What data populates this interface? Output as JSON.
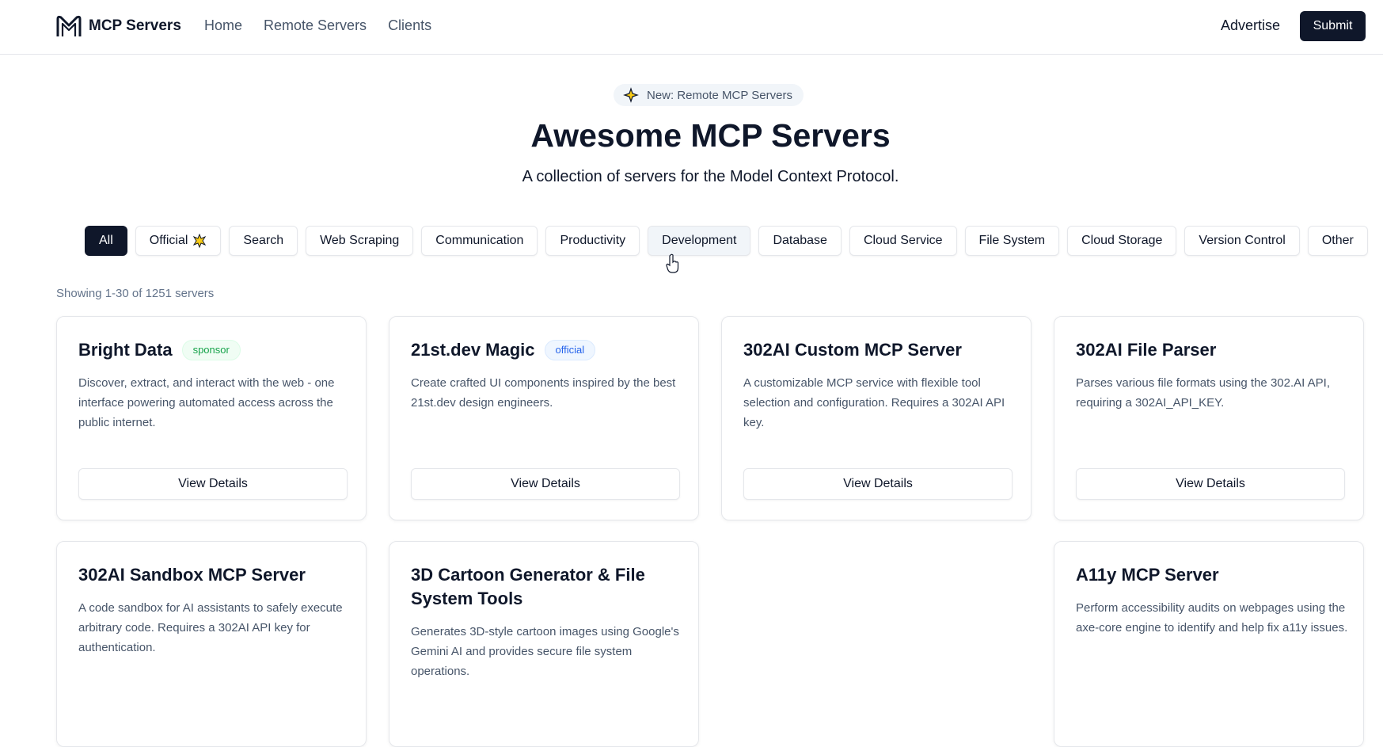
{
  "header": {
    "logo_text": "MCP Servers",
    "nav": [
      "Home",
      "Remote Servers",
      "Clients"
    ],
    "advertise": "Advertise",
    "submit": "Submit"
  },
  "hero": {
    "announcement": "New: Remote MCP Servers",
    "title": "Awesome MCP Servers",
    "subtitle": "A collection of servers for the Model Context Protocol."
  },
  "filters": {
    "items": [
      "All",
      "Official",
      "Search",
      "Web Scraping",
      "Communication",
      "Productivity",
      "Development",
      "Database",
      "Cloud Service",
      "File System",
      "Cloud Storage",
      "Version Control",
      "Other"
    ],
    "active": "All"
  },
  "showing": "Showing 1-30 of 1251 servers",
  "cards": [
    {
      "title": "Bright Data",
      "badge": "sponsor",
      "desc": "Discover, extract, and interact with the web - one interface powering automated access across the public internet.",
      "button": "View Details"
    },
    {
      "title": "21st.dev Magic",
      "badge": "official",
      "desc": "Create crafted UI components inspired by the best 21st.dev design engineers.",
      "button": "View Details"
    },
    {
      "title": "302AI Custom MCP Server",
      "badge": "",
      "desc": "A customizable MCP service with flexible tool selection and configuration. Requires a 302AI API key.",
      "button": "View Details"
    },
    {
      "title": "302AI File Parser",
      "badge": "",
      "desc": "Parses various file formats using the 302.AI API, requiring a 302AI_API_KEY.",
      "button": "View Details"
    },
    {
      "title": "302AI Sandbox MCP Server",
      "badge": "",
      "desc": "A code sandbox for AI assistants to safely execute arbitrary code. Requires a 302AI API key for authentication."
    },
    {
      "title": "3D Cartoon Generator & File System Tools",
      "badge": "",
      "desc": "Generates 3D-style cartoon images using Google's Gemini AI and provides secure file system operations."
    },
    {
      "title": "A11y MCP Server",
      "badge": "",
      "desc": "Perform accessibility audits on webpages using the axe-core engine to identify and help fix a11y issues."
    }
  ],
  "colors": {
    "primary": "#0f172a",
    "muted": "#475569",
    "sponsor": "#16a34a",
    "official": "#2563eb"
  }
}
